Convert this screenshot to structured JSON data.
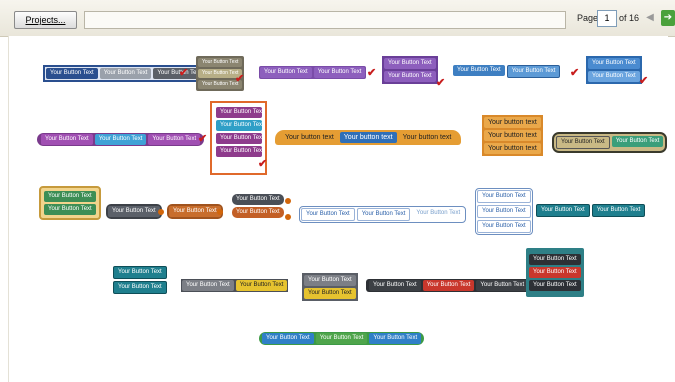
{
  "toolbar": {
    "projects_label": "Projects...",
    "page_label": "Page",
    "page_value": "1",
    "of_label": "of 16",
    "prev_icon": "arrow-left-icon",
    "next_icon": "arrow-right-icon"
  },
  "button_text": "Your Button Text",
  "button_text_lower": "Your button text",
  "colors": {
    "navy": "#2a4f8f",
    "gray": "#7c7f86",
    "purple": "#7a4ca8",
    "blue": "#3e7fc2",
    "teal": "#2f8f9a",
    "orange": "#e29a2a",
    "green": "#4fa54b",
    "red": "#c9372c",
    "dark": "#3c3f44",
    "gold": "#d9b15a",
    "check_red": "#c81e1e"
  }
}
